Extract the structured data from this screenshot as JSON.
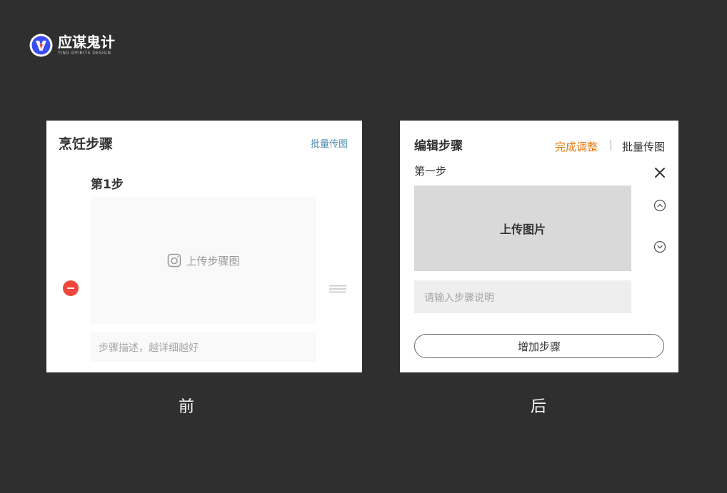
{
  "logo": {
    "name": "应谋鬼计",
    "subtitle": "YING DPIRITS DESIGN",
    "mark_icon": "brand-v-logo-icon",
    "colors": {
      "primary": "#3a4cf2",
      "accent": "#f0463c"
    }
  },
  "before": {
    "title": "烹饪步骤",
    "batch_upload": "批量传图",
    "step_label": "第1步",
    "upload_label": "上传步骤图",
    "upload_icon": "camera-icon",
    "description_placeholder": "步骤描述，越详细越好",
    "remove_icon": "minus-circle-icon",
    "drag_icon": "drag-handle-icon",
    "caption": "前"
  },
  "after": {
    "title": "编辑步骤",
    "done_adjust": "完成调整",
    "separator": "|",
    "batch_upload": "批量传图",
    "step_label": "第一步",
    "close_icon": "close-icon",
    "move_up_icon": "chevron-up-circle-icon",
    "move_down_icon": "chevron-down-circle-icon",
    "upload_label": "上传图片",
    "description_placeholder": "请输入步骤说明",
    "add_step": "增加步骤",
    "caption": "后"
  },
  "colors": {
    "background": "#2f2f2f",
    "link_blue": "#4f8dad",
    "orange": "#e5780f",
    "remove_red": "#f0463c"
  }
}
